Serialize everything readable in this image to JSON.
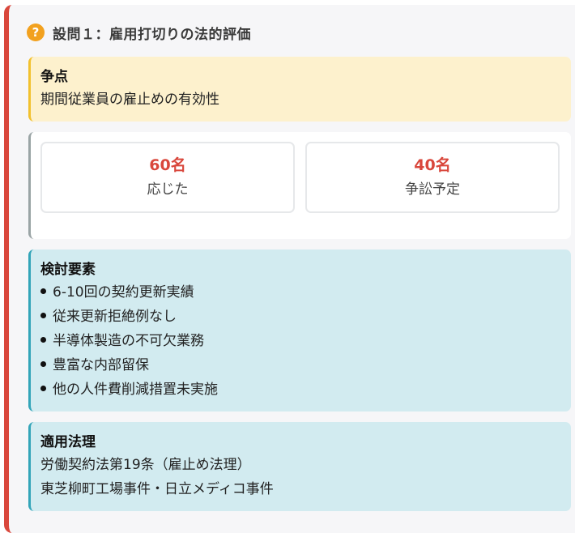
{
  "header": {
    "icon": "question-icon",
    "icon_glyph": "?",
    "title": "設問１：雇用打切りの法的評価",
    "accent_color": "#d9473c"
  },
  "issue": {
    "title": "争点",
    "text": "期間従業員の雇止めの有効性",
    "color": "#fdf1cd"
  },
  "stats": [
    {
      "value": "60名",
      "label": "応じた"
    },
    {
      "value": "40名",
      "label": "争訟予定"
    }
  ],
  "factors": {
    "title": "検討要素",
    "items": [
      "6-10回の契約更新実績",
      "従来更新拒絶例なし",
      "半導体製造の不可欠業務",
      "豊富な内部留保",
      "他の人件費削減措置未実施"
    ],
    "color": "#d2ebf0"
  },
  "law": {
    "title": "適用法理",
    "lines": [
      "労働契約法第19条（雇止め法理）",
      "東芝柳町工場事件・日立メディコ事件"
    ]
  }
}
